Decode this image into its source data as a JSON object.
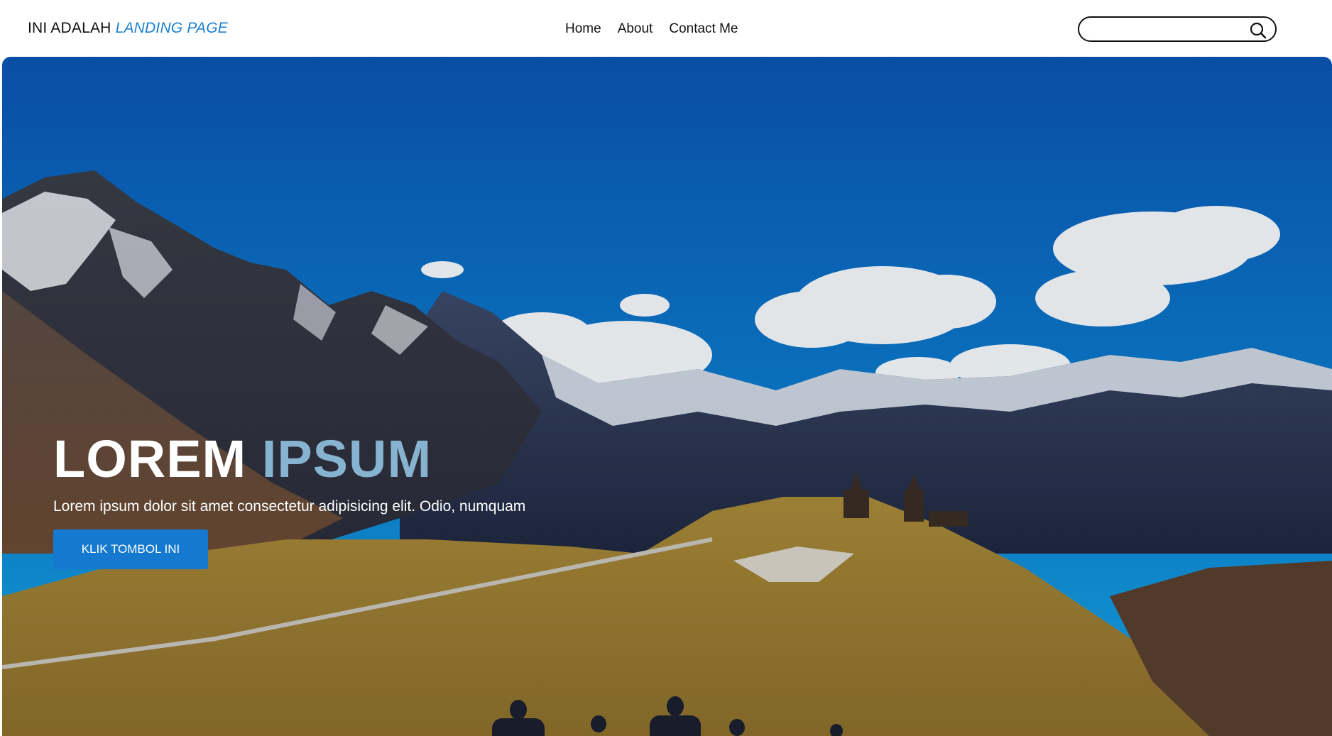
{
  "navbar": {
    "brand_prefix": "INI ADALAH",
    "brand_accent": "LANDING PAGE",
    "links": [
      "Home",
      "About",
      "Contact Me"
    ],
    "search_placeholder": ""
  },
  "hero": {
    "title_word1": "LOREM",
    "title_word2": "IPSUM",
    "subtitle": "Lorem ipsum dolor sit amet consectetur adipisicing elit. Odio, numquam",
    "button_label": "KLIK TOMBOL INI"
  },
  "colors": {
    "accent": "#1a7fd0",
    "button": "#1479cf",
    "title_accent": "#86b3d0"
  },
  "icons": {
    "search": "search-icon"
  }
}
